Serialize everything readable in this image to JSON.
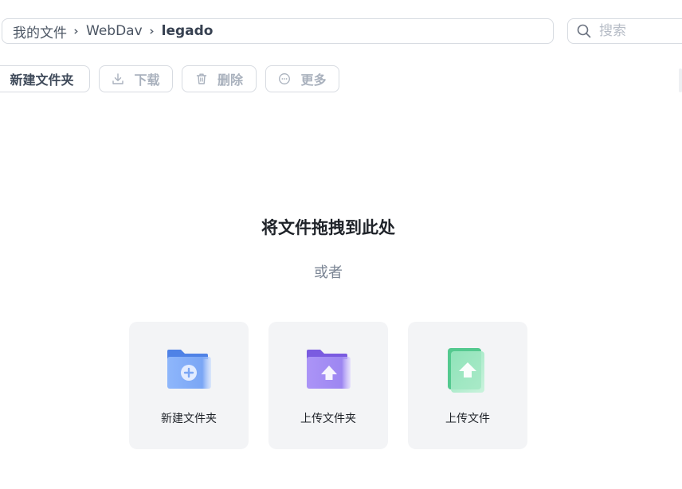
{
  "breadcrumb": {
    "root": "我的文件",
    "items": [
      "WebDav",
      "legado"
    ]
  },
  "search": {
    "placeholder": "搜索"
  },
  "toolbar": {
    "new_folder": "新建文件夹",
    "download": "下载",
    "delete": "删除",
    "more": "更多"
  },
  "dropzone": {
    "title": "将文件拖拽到此处",
    "or": "或者"
  },
  "actions": [
    {
      "label": "新建文件夹",
      "icon": "folder-plus-icon",
      "color": "#5b8ff0"
    },
    {
      "label": "上传文件夹",
      "icon": "folder-upload-icon",
      "color": "#8b6fe8"
    },
    {
      "label": "上传文件",
      "icon": "file-upload-icon",
      "color": "#5cd09d"
    }
  ]
}
